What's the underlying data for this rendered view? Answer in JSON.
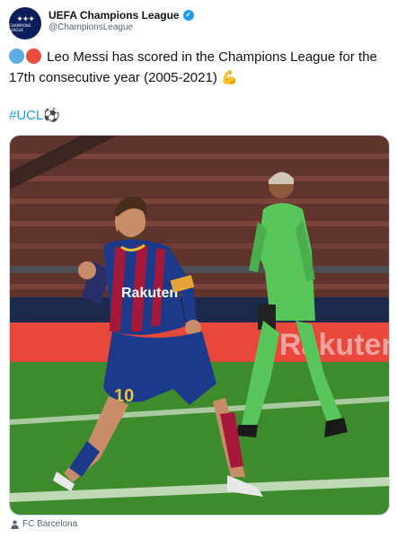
{
  "account": {
    "display_name": "UEFA Champions League",
    "handle": "@ChampionsLeague",
    "avatar_text": "CHAMPIONS LEAGUE",
    "verified_icon": "verified-badge-icon"
  },
  "tweet": {
    "text": "Leo Messi has scored in the Champions League for the 17th consecutive year (2005-2021)",
    "hashtag": "#UCL",
    "leading_emoji": [
      "blue-circle-icon",
      "red-circle-icon"
    ],
    "trailing_emoji": "flexed-biceps-icon",
    "hashtag_emoji": "soccer-ball-icon"
  },
  "media": {
    "jersey_sponsor": "Rakuten",
    "jersey_number": "10",
    "ad_board_text": "Rakuten.co",
    "credit": "FC Barcelona",
    "colors": {
      "pitch": "#3e8b2e",
      "stands": "#6b3a32",
      "board": "#e8473c",
      "keeper": "#58c65a",
      "barca_blue": "#1d3a8a",
      "barca_red": "#a5183a"
    }
  }
}
